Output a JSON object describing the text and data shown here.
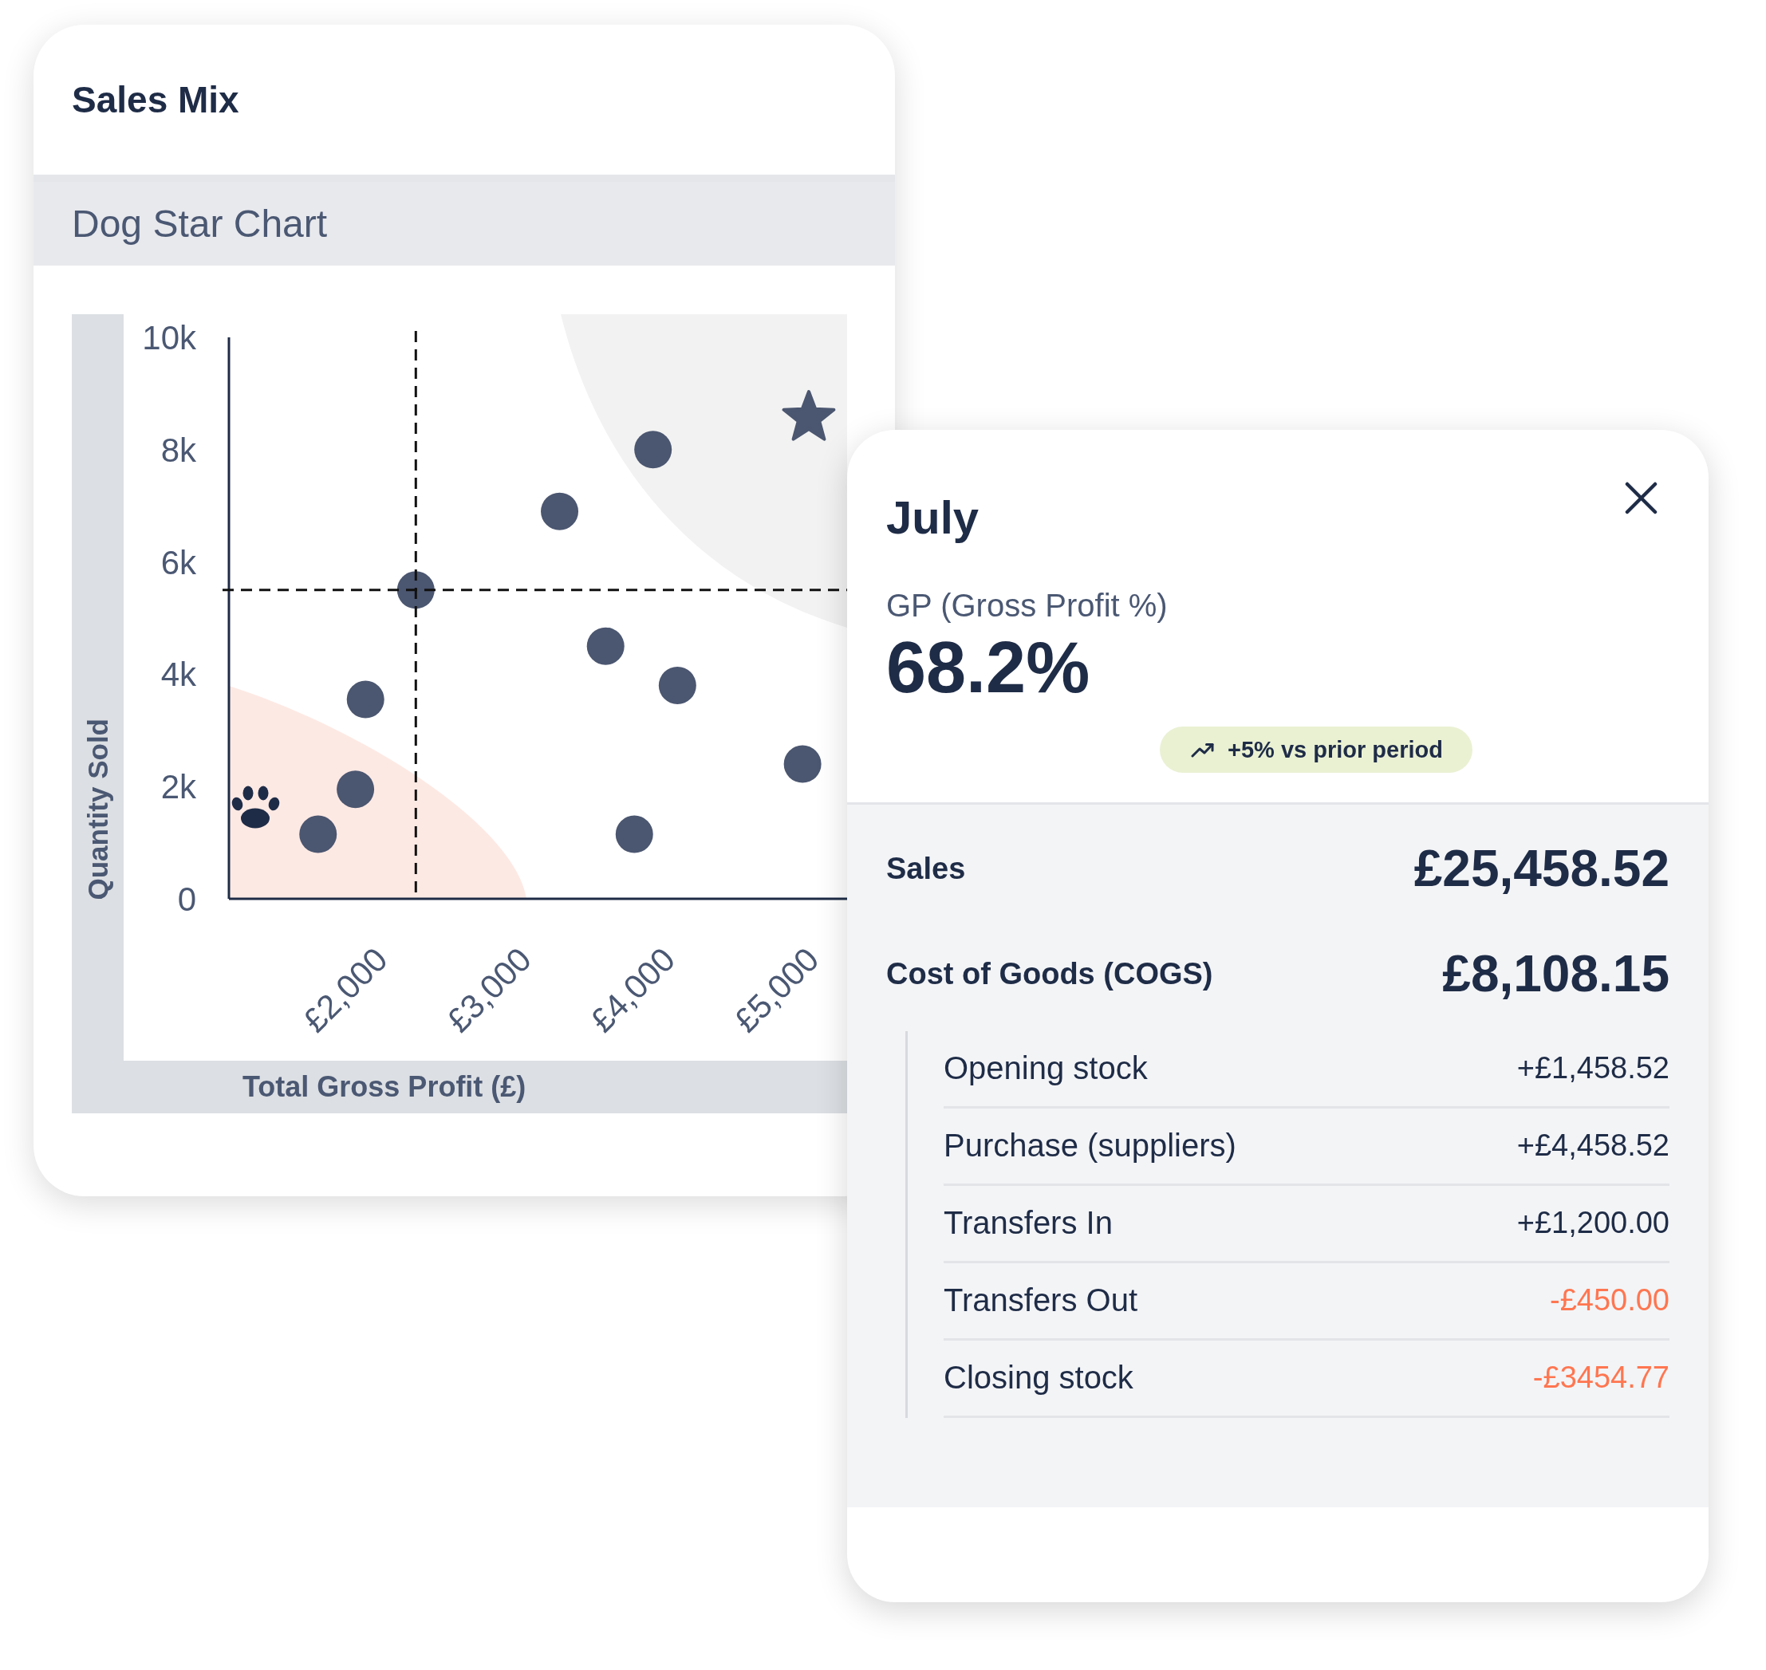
{
  "chart_card": {
    "title": "Sales Mix",
    "subtitle": "Dog Star Chart",
    "chart_data": {
      "type": "scatter",
      "xlabel": "Total Gross Profit (£)",
      "ylabel": "Quantity Sold",
      "x": [
        3900,
        3250,
        2250,
        3570,
        4070,
        1900,
        1830,
        1570,
        3770,
        4940
      ],
      "series": [
        {
          "color": "#4b5670",
          "values": [
            8000,
            6900,
            5500,
            4500,
            3800,
            3550,
            1950,
            1150,
            1150,
            2400
          ]
        }
      ],
      "xlim": [
        950,
        5250
      ],
      "ylim": [
        0,
        10000
      ],
      "xticks": [
        {
          "value": 2000,
          "label": "£2,000"
        },
        {
          "value": 3000,
          "label": "£3,000"
        },
        {
          "value": 4000,
          "label": "£4,000"
        },
        {
          "value": 5000,
          "label": "£5,000"
        }
      ],
      "yticks": [
        {
          "value": 0,
          "label": "0"
        },
        {
          "value": 2000,
          "label": "2k"
        },
        {
          "value": 4000,
          "label": "4k"
        },
        {
          "value": 6000,
          "label": "6k"
        },
        {
          "value": 8000,
          "label": "8k"
        },
        {
          "value": 10000,
          "label": "10k"
        }
      ],
      "ref_lines": [
        {
          "axis": "x",
          "value": 2250
        },
        {
          "axis": "y",
          "value": 5500
        }
      ]
    }
  },
  "detail_card": {
    "title": "July",
    "metric_label": "GP (Gross Profit %)",
    "metric_value": "68.2%",
    "change_badge": "+5% vs prior period",
    "summary": [
      {
        "label": "Sales",
        "value": "£25,458.52"
      },
      {
        "label": "Cost of Goods (COGS)",
        "value": "£8,108.15"
      }
    ],
    "cogs_breakdown": [
      {
        "label": "Opening stock",
        "value": "+£1,458.52",
        "color": "#1f2c47"
      },
      {
        "label": "Purchase (suppliers)",
        "value": "+£4,458.52",
        "color": "#1f2c47"
      },
      {
        "label": "Transfers In",
        "value": "+£1,200.00",
        "color": "#1f2c47"
      },
      {
        "label": "Transfers Out",
        "value": "-£450.00",
        "color": "#ff7650"
      },
      {
        "label": "Closing stock",
        "value": "-£3454.77",
        "color": "#ff7650"
      }
    ]
  }
}
